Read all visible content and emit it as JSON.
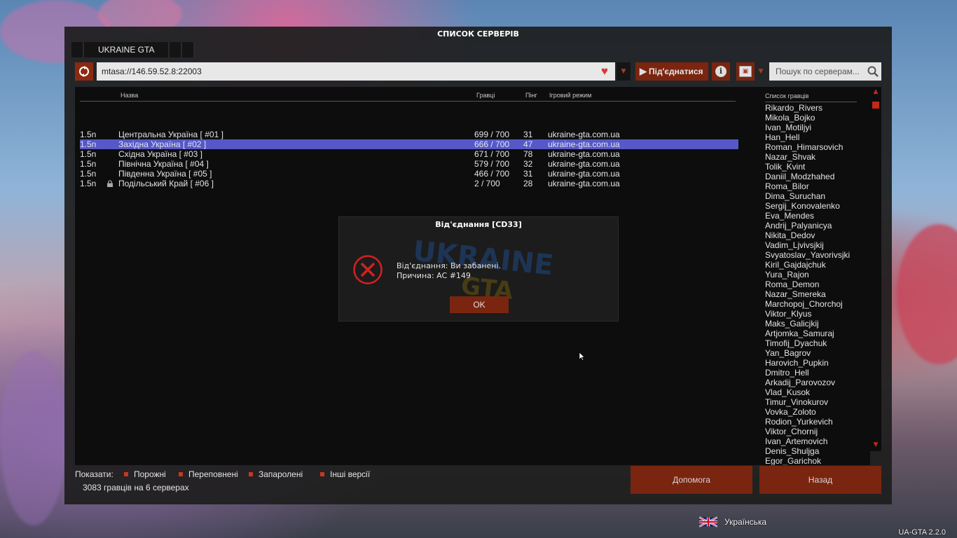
{
  "window": {
    "title": "СПИСОК СЕРВЕРІВ"
  },
  "tabs": [
    {
      "label": "UKRAINE GTA"
    }
  ],
  "toolbar": {
    "refresh_icon": "refresh-icon",
    "address": "mtasa://146.59.52.8:22003",
    "favorite_icon": "heart-icon",
    "connect_label": "Під'єднатися",
    "search_placeholder": "Пошук по серверам..."
  },
  "columns": {
    "name": "Назва",
    "players": "Гравці",
    "ping": "Пінг",
    "gamemode": "Ігровий режим"
  },
  "servers": [
    {
      "version": "1.5n",
      "name": "Центральна Україна [ #01 ]",
      "players": "699 / 700",
      "ping": "31",
      "gamemode": "ukraine-gta.com.ua",
      "locked": false,
      "selected": false
    },
    {
      "version": "1.5n",
      "name": "Західна Україна [ #02 ]",
      "players": "666 / 700",
      "ping": "47",
      "gamemode": "ukraine-gta.com.ua",
      "locked": false,
      "selected": true
    },
    {
      "version": "1.5n",
      "name": "Східна Україна [ #03 ]",
      "players": "671 / 700",
      "ping": "78",
      "gamemode": "ukraine-gta.com.ua",
      "locked": false,
      "selected": false
    },
    {
      "version": "1.5n",
      "name": "Північна Україна [ #04 ]",
      "players": "579 / 700",
      "ping": "32",
      "gamemode": "ukraine-gta.com.ua",
      "locked": false,
      "selected": false
    },
    {
      "version": "1.5n",
      "name": "Південна Україна [ #05 ]",
      "players": "466 / 700",
      "ping": "31",
      "gamemode": "ukraine-gta.com.ua",
      "locked": false,
      "selected": false
    },
    {
      "version": "1.5n",
      "name": "Подільський Край [ #06 ]",
      "players": "2 / 700",
      "ping": "28",
      "gamemode": "ukraine-gta.com.ua",
      "locked": true,
      "selected": false
    }
  ],
  "players_panel": {
    "title": "Список гравців",
    "players": [
      "Rikardo_Rivers",
      "Mikola_Bojko",
      "Ivan_Motiljyi",
      "Han_Hell",
      "Roman_Himarsovich",
      "Nazar_Shvak",
      "Tolik_Kvint",
      "Daniil_Modzhahed",
      "Roma_Bilor",
      "Dima_Suruchan",
      "Sergij_Konovalenko",
      "Eva_Mendes",
      "Andrij_Palyanicya",
      "Nikita_Dedov",
      "Vadim_Ljvivsjkij",
      "Svyatoslav_Yavorivsjki",
      "Kiril_Gajdajchuk",
      "Yura_Rajon",
      "Roma_Demon",
      "Nazar_Smereka",
      "Marchopoj_Chorchoj",
      "Viktor_Klyus",
      "Maks_Galicjkij",
      "Artjomka_Samuraj",
      "Timofij_Dyachuk",
      "Yan_Bagrov",
      "Harovich_Pupkin",
      "Dmitro_Hell",
      "Arkadij_Parovozov",
      "Vlad_Kusok",
      "Timur_Vinokurov",
      "Vovka_Zoloto",
      "Rodion_Yurkevich",
      "Viktor_Chornij",
      "Ivan_Artemovich",
      "Denis_Shuljga",
      "Egor_Garichok"
    ]
  },
  "filters": {
    "label": "Показати:",
    "items": [
      "Порожні",
      "Переповнені",
      "Запаролені",
      "Інші версії"
    ]
  },
  "status": "3083 гравців на 6 серверах",
  "buttons": {
    "help": "Допомога",
    "back": "Назад"
  },
  "dialog": {
    "title": "Від'єднання [CD33]",
    "line1": "Від'єднання: Ви забанені.",
    "line2": "Причина: AC #149",
    "ok": "OK",
    "watermark_top": "UKRAINE",
    "watermark_bottom": "GTA"
  },
  "language": {
    "label": "Українська"
  },
  "version": "UA-GTA 2.2.0",
  "colors": {
    "accent": "#7a2510",
    "selection": "#5658c8",
    "error": "#d42020"
  }
}
